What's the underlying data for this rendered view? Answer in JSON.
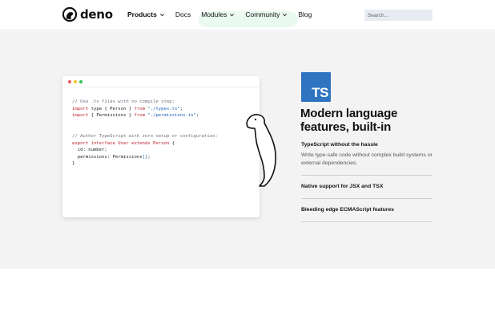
{
  "brand": {
    "name": "deno",
    "accent": "#2f74c0"
  },
  "nav": {
    "items": [
      {
        "label": "Products",
        "dropdown": true,
        "bold": true
      },
      {
        "label": "Docs",
        "dropdown": false,
        "bold": false
      },
      {
        "label": "Modules",
        "dropdown": true,
        "bold": false
      },
      {
        "label": "Community",
        "dropdown": true,
        "bold": false
      },
      {
        "label": "Blog",
        "dropdown": false,
        "bold": false
      }
    ],
    "search_placeholder": "Search..."
  },
  "code": {
    "lines": [
      [
        {
          "t": "// Use .ts files with no compile step:",
          "c": "com"
        }
      ],
      [
        {
          "t": "import",
          "c": "kw"
        },
        {
          "t": " type { Person } ",
          "c": ""
        },
        {
          "t": "from",
          "c": "kw"
        },
        {
          "t": " \"./types.ts\"",
          "c": "str"
        },
        {
          "t": ";",
          "c": ""
        }
      ],
      [
        {
          "t": "import",
          "c": "kw"
        },
        {
          "t": " { Permissions } ",
          "c": ""
        },
        {
          "t": "from",
          "c": "kw"
        },
        {
          "t": " \"./permissions.ts\"",
          "c": "str"
        },
        {
          "t": ";",
          "c": ""
        }
      ],
      [],
      [],
      [
        {
          "t": "// Author TypeScript with zero setup or configuration:",
          "c": "com"
        }
      ],
      [
        {
          "t": "export interface User extends Person",
          "c": "kw"
        },
        {
          "t": " {",
          "c": ""
        }
      ],
      [
        {
          "t": "  id: number;",
          "c": ""
        }
      ],
      [
        {
          "t": "  permissions: Permissions",
          "c": ""
        },
        {
          "t": "[]",
          "c": "str"
        },
        {
          "t": ";",
          "c": ""
        }
      ],
      [
        {
          "t": "}",
          "c": ""
        }
      ]
    ]
  },
  "feature_section": {
    "logo_text": "TS",
    "title": "Modern language features, built-in",
    "features": [
      {
        "title": "TypeScript without the hassle",
        "description": "Write type-safe code without complex build systems or external dependencies."
      },
      {
        "title": "Native support for JSX and TSX",
        "description": ""
      },
      {
        "title": "Bleeding edge ECMAScript features",
        "description": ""
      }
    ]
  }
}
